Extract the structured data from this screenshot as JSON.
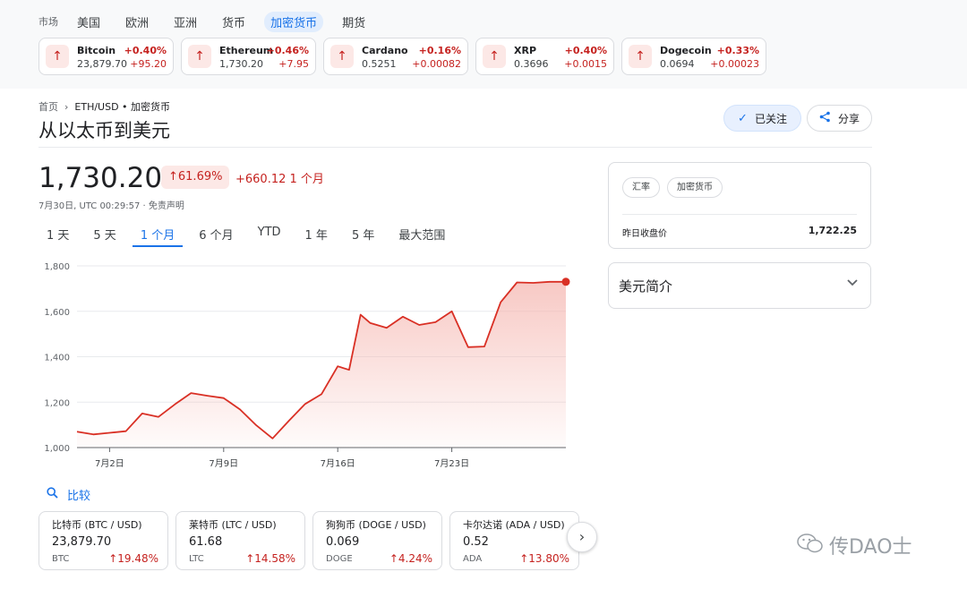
{
  "nav": {
    "label": "市场",
    "items": [
      {
        "label": "美国",
        "active": false
      },
      {
        "label": "欧洲",
        "active": false
      },
      {
        "label": "亚洲",
        "active": false
      },
      {
        "label": "货币",
        "active": false
      },
      {
        "label": "加密货币",
        "active": true
      },
      {
        "label": "期货",
        "active": false
      }
    ]
  },
  "tickers": [
    {
      "name": "Bitcoin",
      "price": "23,879.70",
      "pct": "+0.40%",
      "change": "+95.20",
      "icon": "arrow-up-icon"
    },
    {
      "name": "Ethereum",
      "price": "1,730.20",
      "pct": "+0.46%",
      "change": "+7.95",
      "icon": "arrow-up-icon"
    },
    {
      "name": "Cardano",
      "price": "0.5251",
      "pct": "+0.16%",
      "change": "+0.00082",
      "icon": "arrow-up-icon"
    },
    {
      "name": "XRP",
      "price": "0.3696",
      "pct": "+0.40%",
      "change": "+0.0015",
      "icon": "arrow-up-icon"
    },
    {
      "name": "Dogecoin",
      "price": "0.0694",
      "pct": "+0.33%",
      "change": "+0.00023",
      "icon": "arrow-up-icon"
    }
  ],
  "breadcrumb": {
    "home": "首页",
    "current": "ETH/USD • 加密货币"
  },
  "page_title": "从以太币到美元",
  "buttons": {
    "follow": "已关注",
    "share": "分享"
  },
  "quote": {
    "price": "1,730.20",
    "pct": "↑61.69%",
    "change": "+660.12 1 个月",
    "timestamp": "7月30日, UTC 00:29:57 · 免责声明"
  },
  "ranges": [
    {
      "label": "1 天",
      "active": false
    },
    {
      "label": "5 天",
      "active": false
    },
    {
      "label": "1 个月",
      "active": true
    },
    {
      "label": "6 个月",
      "active": false
    },
    {
      "label": "YTD",
      "active": false
    },
    {
      "label": "1 年",
      "active": false
    },
    {
      "label": "5 年",
      "active": false
    },
    {
      "label": "最大范围",
      "active": false
    }
  ],
  "chart_data": {
    "type": "area",
    "title": "",
    "xlabel": "",
    "ylabel": "",
    "ylim": [
      1000,
      1800
    ],
    "yticks": [
      1000,
      1200,
      1400,
      1600,
      1800
    ],
    "ytick_labels": [
      "1,000",
      "1,200",
      "1,400",
      "1,600",
      "1,800"
    ],
    "xticks": [
      {
        "day": 2,
        "label": "7月2日"
      },
      {
        "day": 9,
        "label": "7月9日"
      },
      {
        "day": 16,
        "label": "7月16日"
      },
      {
        "day": 23,
        "label": "7月23日"
      }
    ],
    "xlim": [
      0,
      30
    ],
    "grid": "horizontal",
    "line_color": "#d93025",
    "fill_color": "#f5b7b1",
    "series": [
      {
        "x": [
          0,
          1,
          2,
          3,
          4,
          5,
          6,
          7,
          8,
          9,
          10,
          11,
          12,
          13,
          14,
          15,
          16,
          16.7,
          17.4,
          18,
          19,
          20,
          21,
          22,
          23,
          24,
          25,
          26,
          27,
          28,
          29,
          30
        ],
        "values": [
          1070,
          1058,
          1065,
          1072,
          1150,
          1135,
          1190,
          1240,
          1228,
          1218,
          1168,
          1098,
          1040,
          1118,
          1192,
          1235,
          1358,
          1342,
          1585,
          1548,
          1527,
          1576,
          1540,
          1552,
          1600,
          1442,
          1445,
          1640,
          1727,
          1725,
          1730,
          1730
        ]
      }
    ]
  },
  "compare": {
    "label": "比较",
    "icon": "search-icon"
  },
  "compare_cards": [
    {
      "name": "比特币 (BTC / USD)",
      "price": "23,879.70",
      "symbol": "BTC",
      "pct": "↑19.48%"
    },
    {
      "name": "莱特币 (LTC / USD)",
      "price": "61.68",
      "symbol": "LTC",
      "pct": "↑14.58%"
    },
    {
      "name": "狗狗币 (DOGE / USD)",
      "price": "0.069",
      "symbol": "DOGE",
      "pct": "↑4.24%"
    },
    {
      "name": "卡尔达诺 (ADA / USD)",
      "price": "0.52",
      "symbol": "ADA",
      "pct": "↑13.80%"
    }
  ],
  "info_panel": {
    "chips": [
      "汇率",
      "加密货币"
    ],
    "prev_close_label": "昨日收盘价",
    "prev_close_value": "1,722.25"
  },
  "about_panel": {
    "title": "美元简介"
  },
  "watermark": {
    "text": "传DAO士"
  }
}
